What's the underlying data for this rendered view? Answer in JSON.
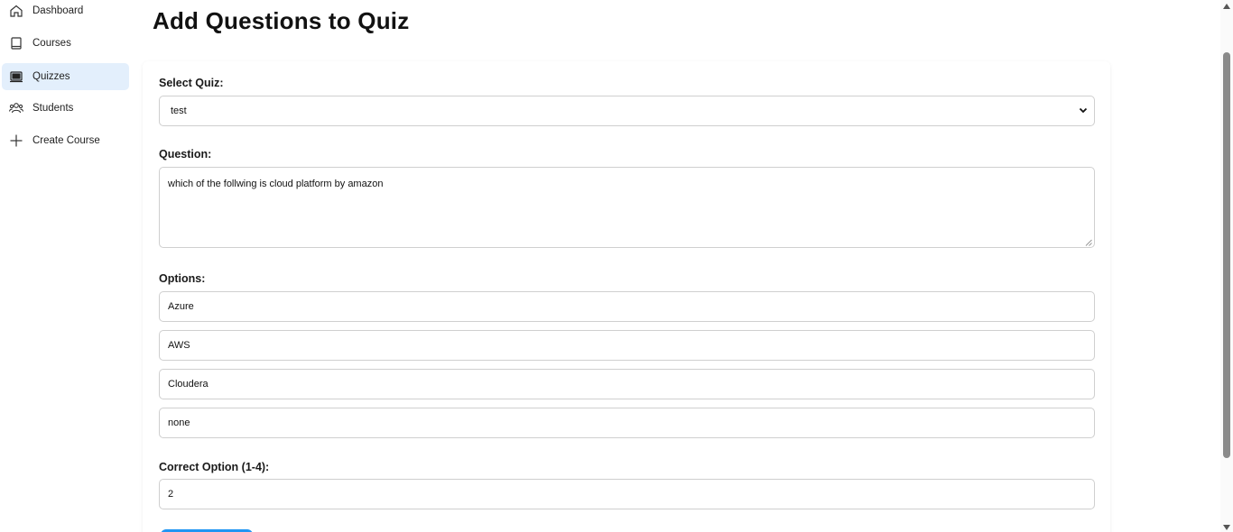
{
  "sidebar": {
    "items": [
      {
        "label": "Dashboard",
        "icon": "home-icon",
        "active": false
      },
      {
        "label": "Courses",
        "icon": "book-icon",
        "active": false
      },
      {
        "label": "Quizzes",
        "icon": "quiz-icon",
        "active": true
      },
      {
        "label": "Students",
        "icon": "users-icon",
        "active": false
      },
      {
        "label": "Create Course",
        "icon": "plus-icon",
        "active": false
      }
    ]
  },
  "page": {
    "title": "Add Questions to Quiz"
  },
  "form": {
    "quiz_label": "Select Quiz:",
    "quiz_value": "test",
    "question_label": "Question:",
    "question_value": "which of the follwing is cloud platform by amazon",
    "options_label": "Options:",
    "options": [
      "Azure",
      "AWS",
      "Cloudera",
      "none"
    ],
    "correct_label": "Correct Option (1-4):",
    "correct_value": "2"
  },
  "colors": {
    "accent": "#2196f3",
    "active_nav_bg": "#e3effc"
  }
}
